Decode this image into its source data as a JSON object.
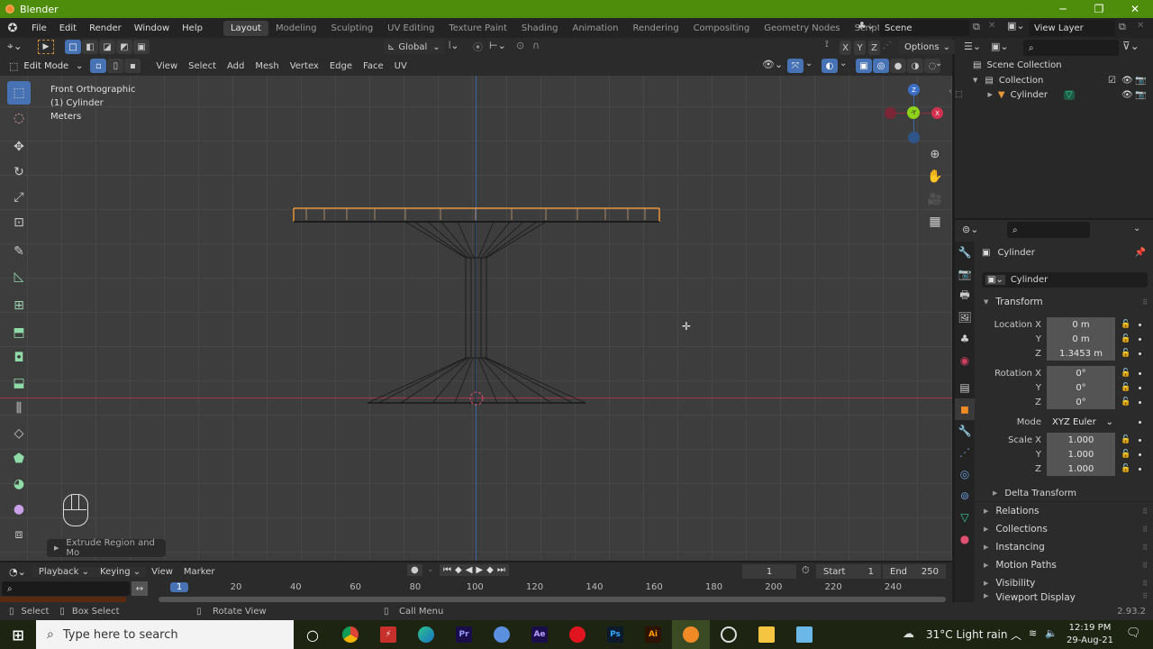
{
  "window": {
    "title": "Blender",
    "minimize": "─",
    "maximize": "❐",
    "close": "✕"
  },
  "menu": [
    "File",
    "Edit",
    "Render",
    "Window",
    "Help"
  ],
  "workspaces": [
    {
      "label": "Layout",
      "active": true
    },
    {
      "label": "Modeling"
    },
    {
      "label": "Sculpting"
    },
    {
      "label": "UV Editing"
    },
    {
      "label": "Texture Paint"
    },
    {
      "label": "Shading"
    },
    {
      "label": "Animation"
    },
    {
      "label": "Rendering"
    },
    {
      "label": "Compositing"
    },
    {
      "label": "Geometry Nodes"
    },
    {
      "label": "Scripting"
    }
  ],
  "add_workspace": "+",
  "scene": {
    "name": "Scene",
    "view_layer": "View Layer"
  },
  "viewport_header": {
    "transform_orientation": "Global",
    "axes": [
      "X",
      "Y",
      "Z"
    ],
    "options": "Options",
    "mode": "Edit Mode",
    "menus": [
      "View",
      "Select",
      "Add",
      "Mesh",
      "Vertex",
      "Edge",
      "Face",
      "UV"
    ]
  },
  "viewport": {
    "view_name": "Front Orthographic",
    "object_label": "(1) Cylinder",
    "units": "Meters",
    "last_operator": "Extrude Region and Mo",
    "gizmo": {
      "z": "Z",
      "y": "-Y",
      "x": "X"
    }
  },
  "outliner": {
    "root": "Scene Collection",
    "collection": "Collection",
    "object": "Cylinder"
  },
  "properties": {
    "object_name": "Cylinder",
    "datablock": "Cylinder",
    "section": "Transform",
    "location": {
      "label": "Location X",
      "x": "0 m",
      "y": "0 m",
      "z": "1.3453 m"
    },
    "rotation": {
      "label": "Rotation X",
      "x": "0°",
      "y": "0°",
      "z": "0°"
    },
    "mode_label": "Mode",
    "mode": "XYZ Euler",
    "scale": {
      "label": "Scale X",
      "x": "1.000",
      "y": "1.000",
      "z": "1.000"
    },
    "axis_y": "Y",
    "axis_z": "Z",
    "delta": "Delta Transform",
    "panels": [
      "Relations",
      "Collections",
      "Instancing",
      "Motion Paths",
      "Visibility",
      "Viewport Display"
    ]
  },
  "timeline": {
    "menus": [
      "Playback",
      "Keying",
      "View",
      "Marker"
    ],
    "current_frame": "1",
    "start_label": "Start",
    "start": "1",
    "end_label": "End",
    "end": "250",
    "ticks": [
      "1",
      "20",
      "40",
      "60",
      "80",
      "100",
      "120",
      "140",
      "160",
      "180",
      "200",
      "220",
      "240"
    ]
  },
  "statusbar": {
    "hints": [
      "Select",
      "Box Select",
      "Rotate View",
      "Call Menu"
    ],
    "version": "2.93.2"
  },
  "taskbar": {
    "search_placeholder": "Type here to search",
    "apps": [
      "Cortana",
      "Chrome",
      "Acrobat",
      "Edge",
      "Premiere Pro",
      "Chromium",
      "After Effects",
      "Opera",
      "Photoshop",
      "Illustrator",
      "Blender",
      "OBS",
      "File Explorer",
      "Remote Desktop"
    ],
    "weather": "31°C  Light rain",
    "time": "12:19 PM",
    "date": "29-Aug-21"
  }
}
